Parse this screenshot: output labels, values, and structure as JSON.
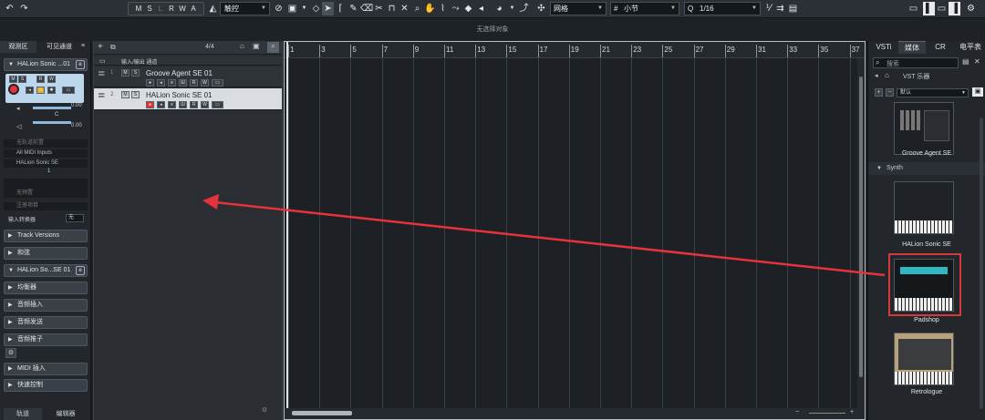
{
  "toolbar": {
    "msrw": [
      "M",
      "S",
      "L",
      "R",
      "W",
      "A"
    ],
    "mode_value": "触控",
    "grid_value": "网格",
    "quantize_value": "小节",
    "q_label": "Q",
    "quant_value": "1/16"
  },
  "status_text": "无选择对象",
  "inspector": {
    "tabs": [
      "观测区",
      "可见通道"
    ],
    "track_name": "HALion Sonic ...01",
    "volume": "0.00",
    "pan_label": "C",
    "pan": "0.00",
    "routing": [
      "无轨道前置",
      "All MIDI Inputs",
      "HALion Sonic SE"
    ],
    "channel": "1",
    "no_bank": "无预置",
    "no_program": "注册项目",
    "input_transform_label": "输入转换器",
    "input_transform_value": "无",
    "sections": [
      "Track Versions",
      "和弦",
      "HALion So...SE 01",
      "均衡器",
      "音频插入",
      "音频发送",
      "音频推子",
      "MIDI 插入",
      "快速控制"
    ],
    "bottom_tabs": [
      "轨道",
      "编辑器"
    ]
  },
  "tracklist": {
    "count": "4/4",
    "folder_name": "输入/输出 通道",
    "tracks": [
      {
        "num": "1",
        "name": "Groove Agent SE 01"
      },
      {
        "num": "2",
        "name": "HALion Sonic SE 01"
      }
    ]
  },
  "ruler": [
    "1",
    "3",
    "5",
    "7",
    "9",
    "11",
    "13",
    "15",
    "17",
    "19",
    "21",
    "23",
    "25",
    "27",
    "29",
    "31",
    "33",
    "35",
    "37"
  ],
  "rightzone": {
    "tabs": [
      "VSTi",
      "媒体",
      "CR",
      "电平表"
    ],
    "search_placeholder": "搜索",
    "breadcrumb": "VST 乐器",
    "preset": "默认",
    "category": "Synth",
    "instruments": [
      "Groove Agent SE",
      "HALion Sonic SE",
      "Padshop",
      "Retrologue"
    ]
  },
  "colors": {
    "accent": "#e5323b",
    "highlight": "#d23a3a",
    "panel": "#23272c"
  }
}
